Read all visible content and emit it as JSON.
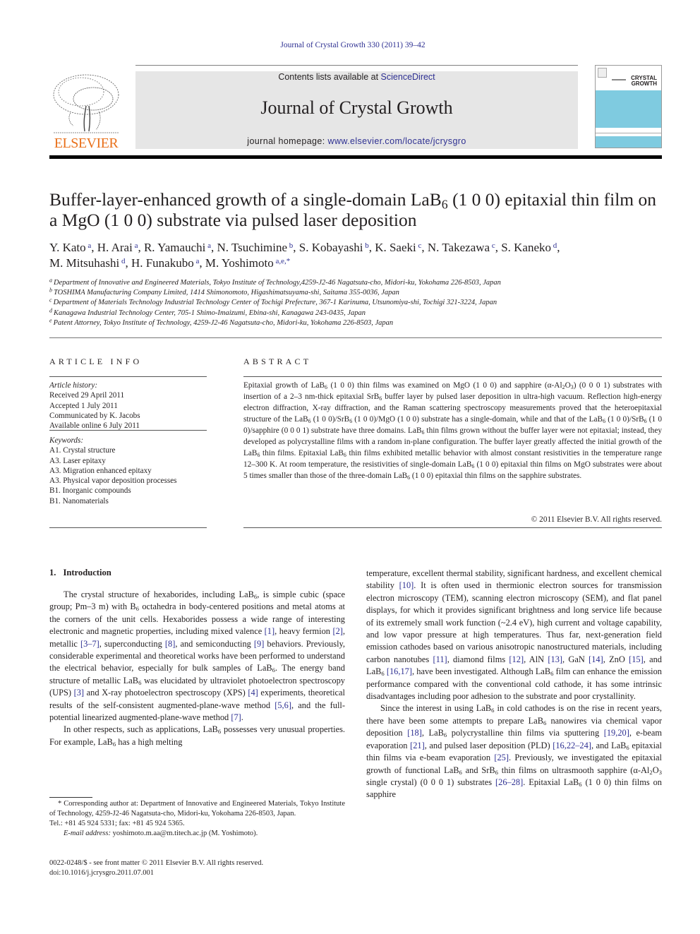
{
  "citation": "Journal of Crystal Growth 330 (2011) 39–42",
  "header": {
    "publisher_logo_text": "ELSEVIER",
    "contents_prefix": "Contents lists available at ",
    "contents_link": "ScienceDirect",
    "journal_name": "Journal of Crystal Growth",
    "homepage_prefix": "journal homepage: ",
    "homepage_link": "www.elsevier.com/locate/jcrysgro",
    "cover_title_line1": "CRYSTAL",
    "cover_title_line2": "GROWTH",
    "colors": {
      "logo_orange": "#e9711c",
      "link_blue": "#2e3092",
      "band_gray": "#e6e6e6",
      "cover_blue": "#7fcbe0"
    }
  },
  "article": {
    "title_part1": "Buffer-layer-enhanced growth of a single-domain LaB",
    "title_sub": "6",
    "title_part2": " (1 0 0) epitaxial thin film on a MgO (1 0 0) substrate via pulsed laser deposition",
    "authors": [
      {
        "name": "Y. Kato",
        "aff": "a"
      },
      {
        "name": "H. Arai",
        "aff": "a"
      },
      {
        "name": "R. Yamauchi",
        "aff": "a"
      },
      {
        "name": "N. Tsuchimine",
        "aff": "b"
      },
      {
        "name": "S. Kobayashi",
        "aff": "b"
      },
      {
        "name": "K. Saeki",
        "aff": "c"
      },
      {
        "name": "N. Takezawa",
        "aff": "c"
      },
      {
        "name": "S. Kaneko",
        "aff": "d"
      },
      {
        "name": "M. Mitsuhashi",
        "aff": "d"
      },
      {
        "name": "H. Funakubo",
        "aff": "a"
      },
      {
        "name": "M. Yoshimoto",
        "aff": "a,e,*"
      }
    ],
    "affiliations": [
      {
        "key": "a",
        "text": "Department of Innovative and Engineered Materials, Tokyo Institute of Technology,4259-J2-46 Nagatsuta-cho, Midori-ku, Yokohama 226-8503, Japan"
      },
      {
        "key": "b",
        "text": "TOSHIMA Manufacturing Company Limited, 1414 Shimonomoto, Higashimatsuyama-shi, Saitama 355-0036, Japan"
      },
      {
        "key": "c",
        "text": "Department of Materials Technology Industrial Technology Center of Tochigi Prefecture, 367-1 Karinuma, Utsunomiya-shi, Tochigi 321-3224, Japan"
      },
      {
        "key": "d",
        "text": "Kanagawa Industrial Technology Center, 705-1 Shimo-Imaizumi, Ebina-shi, Kanagawa 243-0435, Japan"
      },
      {
        "key": "e",
        "text": "Patent Attorney, Tokyo Institute of Technology, 4259-J2-46 Nagatsuta-cho, Midori-ku, Yokohama 226-8503, Japan"
      }
    ]
  },
  "article_info": {
    "heading": "ARTICLE INFO",
    "history_label": "Article history:",
    "history": [
      "Received 29 April 2011",
      "Accepted 1 July 2011",
      "Communicated by K. Jacobs",
      "Available online 6 July 2011"
    ],
    "keywords_label": "Keywords:",
    "keywords": [
      "A1. Crystal structure",
      "A3. Laser epitaxy",
      "A3. Migration enhanced epitaxy",
      "A3. Physical vapor deposition processes",
      "B1. Inorganic compounds",
      "B1. Nanomaterials"
    ]
  },
  "abstract": {
    "heading": "ABSTRACT",
    "text_html": "Epitaxial growth of LaB<sub>6</sub> (1 0 0) thin films was examined on MgO (1 0 0) and sapphire (α-Al<sub>2</sub>O<sub>3</sub>) (0 0 0 1) substrates with insertion of a 2–3 nm-thick epitaxial SrB<sub>6</sub> buffer layer by pulsed laser deposition in ultra-high vacuum. Reflection high-energy electron diffraction, X-ray diffraction, and the Raman scattering spectroscopy measurements proved that the heteroepitaxial structure of the LaB<sub>6</sub> (1 0 0)/SrB<sub>6</sub> (1 0 0)/MgO (1 0 0) substrate has a single-domain, while and that of the LaB<sub>6</sub> (1 0 0)/SrB<sub>6</sub> (1 0 0)/sapphire (0 0 0 1) substrate have three domains. LaB<sub>6</sub> thin films grown without the buffer layer were not epitaxial; instead, they developed as polycrystalline films with a random in-plane configura&shy;tion. The buffer layer greatly affected the initial growth of the LaB<sub>6</sub> thin films. Epitaxial LaB<sub>6</sub> thin films exhibited metallic behavior with almost constant resistivities in the temperature range 12–300 K. At room temperature, the resistivities of single-domain LaB<sub>6</sub> (1 0 0) epitaxial thin films on MgO substrates were about 5 times smaller than those of the three-domain LaB<sub>6</sub> (1 0 0) epitaxial thin films on the sapphire substrates.",
    "copyright": "© 2011 Elsevier B.V. All rights reserved."
  },
  "body": {
    "section_number": "1.",
    "section_title": "Introduction",
    "left_paragraphs_html": [
      "The crystal structure of hexaborides, including LaB<sub>6</sub>, is simple cubic (space group; Pm–3 m) with B<sub>6</sub> octahedra in body-centered positions and metal atoms at the corners of the unit cells. Hex&shy;aborides possess a wide range of interesting electronic and magnetic properties, including mixed valence <span class=\"link\">[1]</span>, heavy fermion <span class=\"link\">[2]</span>, metallic <span class=\"link\">[3–7]</span>, superconducting <span class=\"link\">[8]</span>, and semiconducting <span class=\"link\">[9]</span> behaviors. Pre&shy;viously, considerable experimental and theoretical works have been performed to understand the electrical behavior, especially for bulk samples of LaB<sub>6</sub>. The energy band structure of metallic LaB<sub>6</sub> was elucidated by ultraviolet photoelectron spectroscopy (UPS) <span class=\"link\">[3]</span> and X-ray photoelectron spectroscopy (XPS) <span class=\"link\">[4]</span> experiments, theoretical results of the self-consistent augmented-plane-wave method <span class=\"link\">[5,6]</span>, and the full-potential linearized augmented-plane-wave method <span class=\"link\">[7]</span>.",
      "In other respects, such as applications, LaB<sub>6</sub> possesses very unusual properties. For example, LaB<sub>6</sub> has a high melting"
    ],
    "right_paragraphs_html": [
      "temperature, excellent thermal stability, significant hardness, and excellent chemical stability <span class=\"link\">[10]</span>. It is often used in thermionic electron sources for transmission electron microscopy (TEM), scanning electron microscopy (SEM), and flat panel displays, for which it provides significant brightness and long service life because of its extremely small work function (~2.4 eV), high current and voltage capability, and low vapor pressure at high temperatures. Thus far, next-generation field emission cathodes based on various anisotropic nanostructured materials, including carbon nanotubes <span class=\"link\">[11]</span>, diamond films <span class=\"link\">[12]</span>, AlN <span class=\"link\">[13]</span>, GaN <span class=\"link\">[14]</span>, ZnO <span class=\"link\">[15]</span>, and LaB<sub>6</sub> <span class=\"link\">[16,17]</span>, have been investigated. Although LaB<sub>6</sub> film can enhance the emission performance compared with the conventional cold cathode, it has some intrinsic disadvantages including poor adhesion to the substrate and poor crystallinity.",
      "Since the interest in using LaB<sub>6</sub> in cold cathodes is on the rise in recent years, there have been some attempts to prepare LaB<sub>6</sub> nanowires via chemical vapor deposition <span class=\"link\">[18]</span>, LaB<sub>6</sub> polycrystal&shy;line thin films via sputtering <span class=\"link\">[19,20]</span>, e-beam evaporation <span class=\"link\">[21]</span>, and pulsed laser deposition (PLD) <span class=\"link\">[16,22–24]</span>, and LaB<sub>6</sub> epitaxial thin films via e-beam evaporation <span class=\"link\">[25]</span>. Previously, we investi&shy;gated the epitaxial growth of functional LaB<sub>6</sub> and SrB<sub>6</sub> thin films on ultrasmooth sapphire (α-Al<sub>2</sub>O<sub>3</sub> single crystal) (0 0 0 1) substrates <span class=\"link\">[26–28]</span>. Epitaxial LaB<sub>6</sub> (1 0 0) thin films on sapphire"
    ]
  },
  "footnote": {
    "corresponding": "* Corresponding author at: Department of Innovative and Engineered Materials, Tokyo Institute of Technology, 4259-J2-46 Nagatsuta-cho, Midori-ku, Yokohama 226-8503, Japan.",
    "telfax": "Tel.: +81 45 924 5331; fax: +81 45 924 5365.",
    "email_label": "E-mail address:",
    "email": "yoshimoto.m.aa@m.titech.ac.jp",
    "email_owner": " (M. Yoshimoto)."
  },
  "front_matter": {
    "issn_line": "0022-0248/$ - see front matter © 2011 Elsevier B.V. All rights reserved.",
    "doi": "doi:10.1016/j.jcrysgro.2011.07.001"
  }
}
